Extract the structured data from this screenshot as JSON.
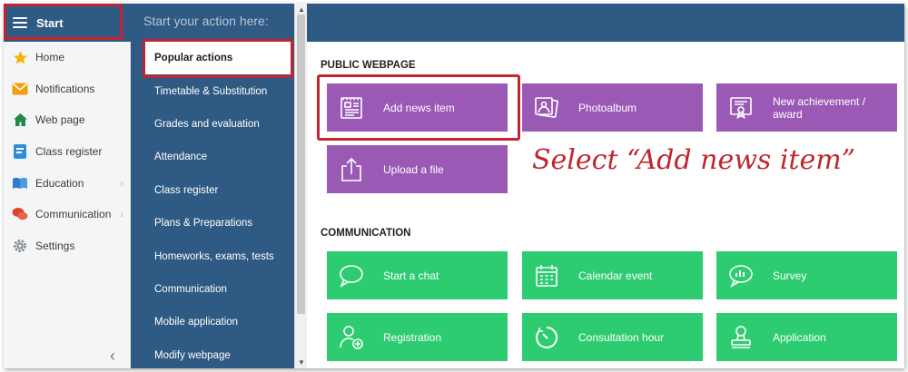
{
  "left_nav": {
    "start_label": "Start",
    "items": [
      {
        "label": "Home",
        "icon": "star-icon"
      },
      {
        "label": "Notifications",
        "icon": "envelope-icon"
      },
      {
        "label": "Web page",
        "icon": "house-icon"
      },
      {
        "label": "Class register",
        "icon": "register-icon"
      },
      {
        "label": "Education",
        "icon": "book-icon"
      },
      {
        "label": "Communication",
        "icon": "chat-bubbles-icon"
      },
      {
        "label": "Settings",
        "icon": "gear-icon"
      }
    ]
  },
  "menu": {
    "title": "Start your action here:",
    "items": [
      "Popular actions",
      "Timetable & Substitution",
      "Grades and evaluation",
      "Attendance",
      "Class register",
      "Plans & Preparations",
      "Homeworks, exams, tests",
      "Communication",
      "Mobile application",
      "Modify webpage"
    ]
  },
  "sections": {
    "public_webpage": {
      "heading": "PUBLIC WEBPAGE",
      "tiles": [
        {
          "label": "Add news item",
          "icon": "newspaper-icon"
        },
        {
          "label": "Photoalbum",
          "icon": "photos-icon"
        },
        {
          "label": "New achievement / award",
          "label_line1": "New achievement /",
          "label_line2": "award",
          "icon": "certificate-icon"
        },
        {
          "label": "Upload a file",
          "icon": "upload-icon"
        }
      ]
    },
    "communication": {
      "heading": "COMMUNICATION",
      "tiles": [
        {
          "label": "Start a chat",
          "icon": "chat-icon"
        },
        {
          "label": "Calendar event",
          "icon": "calendar-icon"
        },
        {
          "label": "Survey",
          "icon": "survey-icon"
        },
        {
          "label": "Registration",
          "icon": "user-add-icon"
        },
        {
          "label": "Consultation hour",
          "icon": "timer-icon"
        },
        {
          "label": "Application",
          "icon": "stamp-icon"
        }
      ]
    }
  },
  "annotation": "Select “Add news item”",
  "colors": {
    "nav_blue": "#2f5a83",
    "tile_purple": "#9b59b6",
    "tile_green": "#2ecc71",
    "highlight_red": "#c42331"
  }
}
